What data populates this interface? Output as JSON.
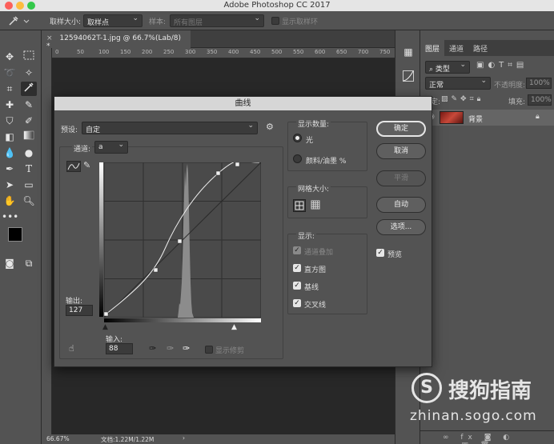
{
  "app": {
    "title": "Adobe Photoshop CC 2017"
  },
  "options_bar": {
    "sample_size_label": "取样大小:",
    "sample_size_value": "取样点",
    "sample_label": "样本:",
    "sample_value": "所有图层",
    "show_ring_label": "显示取样环"
  },
  "document": {
    "tab_label": "12594062T-1.jpg @ 66.7%(Lab/8) *",
    "close_glyph": "×",
    "ruler_ticks": [
      "0",
      "50",
      "100",
      "150",
      "200",
      "250",
      "300",
      "350",
      "400",
      "450",
      "500",
      "550",
      "600",
      "650",
      "700",
      "750"
    ]
  },
  "status": {
    "zoom": "66.67%",
    "doc": "文档:1.22M/1.22M"
  },
  "layers_panel": {
    "tabs": [
      "图层",
      "通道",
      "路径"
    ],
    "kind_label": "类型",
    "blend_mode": "正常",
    "opacity_label": "不透明度:",
    "opacity_value": "100%",
    "lock_label": "锁定:",
    "fill_label": "填充:",
    "fill_value": "100%",
    "layer_name": "背景"
  },
  "dialog": {
    "title": "曲线",
    "preset_label": "预设:",
    "preset_value": "自定",
    "channel_label": "通道:",
    "channel_value": "a",
    "output_label": "输出:",
    "output_value": "127",
    "input_label": "输入:",
    "input_value": "88",
    "show_clipping_label": "显示修剪",
    "show_amount_title": "显示数量:",
    "light_label": "光",
    "pigment_label": "颜料/油墨 %",
    "grid_size_title": "网格大小:",
    "show_title": "显示:",
    "channel_overlay_label": "通道叠加",
    "histogram_label": "直方图",
    "baseline_label": "基线",
    "intersection_label": "交叉线",
    "buttons": {
      "ok": "确定",
      "cancel": "取消",
      "smooth": "平滑",
      "auto": "自动",
      "options": "选项..."
    },
    "preview_label": "预览",
    "check_glyph": "✓"
  },
  "watermark": {
    "brand": "搜狗指南",
    "url": "zhinan.sogo.com",
    "logo_letter": "S"
  }
}
